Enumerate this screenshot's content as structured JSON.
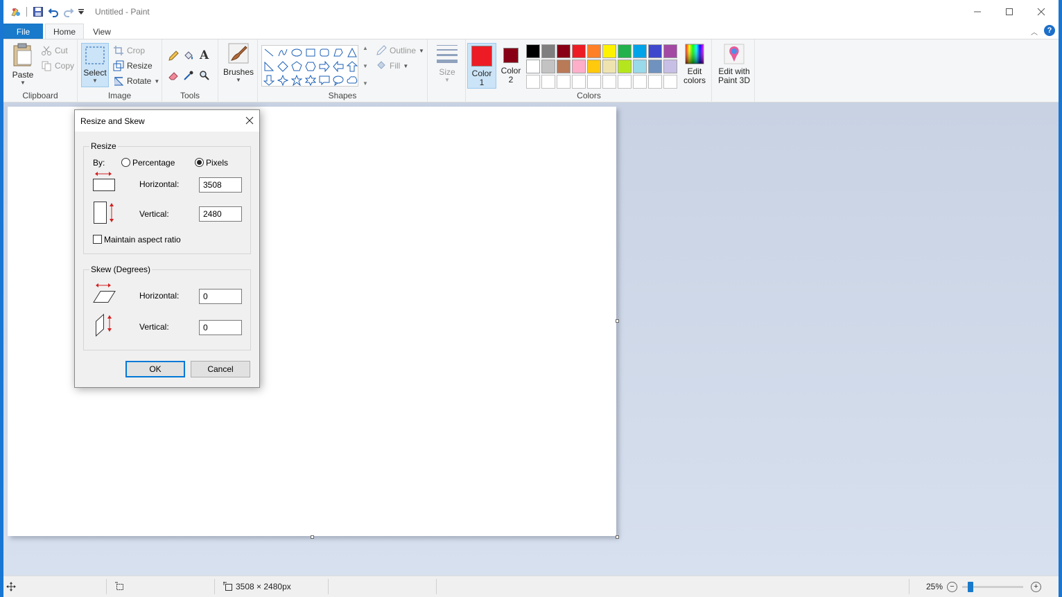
{
  "window": {
    "title": "Untitled - Paint"
  },
  "tabs": {
    "file": "File",
    "home": "Home",
    "view": "View"
  },
  "ribbon": {
    "clipboard": {
      "label": "Clipboard",
      "paste": "Paste",
      "cut": "Cut",
      "copy": "Copy"
    },
    "image": {
      "label": "Image",
      "select": "Select",
      "crop": "Crop",
      "resize": "Resize",
      "rotate": "Rotate"
    },
    "tools": {
      "label": "Tools"
    },
    "brushes": {
      "label": "Brushes"
    },
    "shapes": {
      "label": "Shapes",
      "outline": "Outline",
      "fill": "Fill"
    },
    "size": {
      "label": "Size"
    },
    "colors": {
      "label": "Colors",
      "color1_line1": "Color",
      "color1_line2": "1",
      "color1_value": "#ed1c24",
      "color2_line1": "Color",
      "color2_line2": "2",
      "color2_value": "#880015",
      "edit_colors_line1": "Edit",
      "edit_colors_line2": "colors",
      "edit_paint3d_line1": "Edit with",
      "edit_paint3d_line2": "Paint 3D",
      "palette": [
        "#000000",
        "#7f7f7f",
        "#880015",
        "#ed1c24",
        "#ff7f27",
        "#fff200",
        "#22b14c",
        "#00a2e8",
        "#3f48cc",
        "#a349a4",
        "#ffffff",
        "#c3c3c3",
        "#b97a57",
        "#ffaec9",
        "#ffc90e",
        "#efe4b0",
        "#b5e61d",
        "#99d9ea",
        "#7092be",
        "#c8bfe7",
        "#ffffff",
        "#ffffff",
        "#ffffff",
        "#ffffff",
        "#ffffff",
        "#ffffff",
        "#ffffff",
        "#ffffff",
        "#ffffff",
        "#ffffff"
      ]
    }
  },
  "dialog": {
    "title": "Resize and Skew",
    "resize": {
      "legend": "Resize",
      "by_label": "By:",
      "percentage_label": "Percentage",
      "pixels_label": "Pixels",
      "selected_mode": "Pixels",
      "horizontal_label": "Horizontal:",
      "horizontal_value": "3508",
      "vertical_label": "Vertical:",
      "vertical_value": "2480",
      "maintain_aspect_label": "Maintain aspect ratio",
      "maintain_aspect_checked": false
    },
    "skew": {
      "legend": "Skew (Degrees)",
      "horizontal_label": "Horizontal:",
      "horizontal_value": "0",
      "vertical_label": "Vertical:",
      "vertical_value": "0"
    },
    "ok_label": "OK",
    "cancel_label": "Cancel"
  },
  "statusbar": {
    "image_size": "3508 × 2480px",
    "zoom": "25%",
    "zoom_minus": "−",
    "zoom_plus": "+"
  }
}
